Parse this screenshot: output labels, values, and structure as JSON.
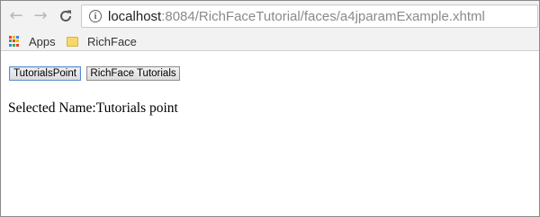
{
  "browser": {
    "url_host": "localhost",
    "url_path": ":8084/RichFaceTutorial/faces/a4jparamExample.xhtml",
    "bookmarks": [
      {
        "label": "Apps",
        "icon": "apps-grid-icon"
      },
      {
        "label": "RichFace",
        "icon": "folder-icon"
      }
    ]
  },
  "page": {
    "buttons": [
      {
        "label": "TutorialsPoint"
      },
      {
        "label": "RichFace Tutorials"
      }
    ],
    "selected_label": "Selected Name:",
    "selected_value": "Tutorials point"
  }
}
